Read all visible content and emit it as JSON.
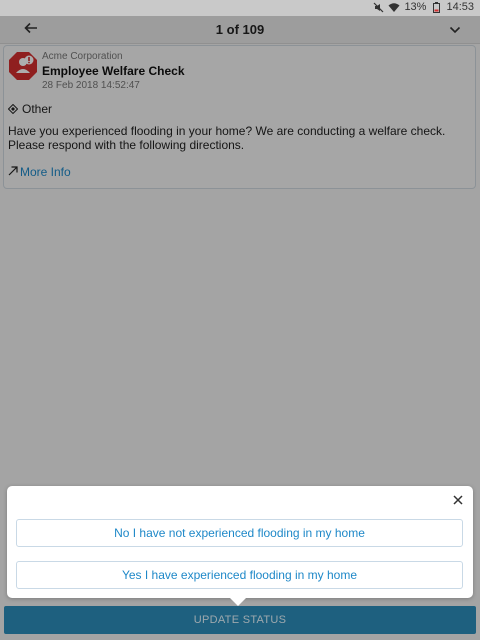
{
  "status_bar": {
    "battery_percent": "13%",
    "time": "14:53",
    "icons": [
      "mute-icon",
      "wifi-icon",
      "battery-low-icon"
    ]
  },
  "nav": {
    "title": "1 of 109",
    "back_icon": "arrow-left-icon",
    "menu_icon": "chevron-down-icon"
  },
  "message": {
    "organization": "Acme Corporation",
    "subject": "Employee Welfare Check",
    "date": "28 Feb 2018 14:52:47",
    "category": "Other",
    "body": "Have you experienced flooding in your home? We are conducting a welfare check. Please respond with the following directions.",
    "more_info": "More Info",
    "logo_icon": "alert-stop-sign-icon",
    "logo_color": "#d32f2f"
  },
  "popover": {
    "close_icon": "close-icon",
    "options": [
      "No I have not experienced flooding in my home",
      "Yes I have experienced flooding in my home"
    ]
  },
  "update_button": {
    "label": "UPDATE STATUS",
    "color": "#2a86b0"
  },
  "colors": {
    "accent": "#1e88c8"
  }
}
